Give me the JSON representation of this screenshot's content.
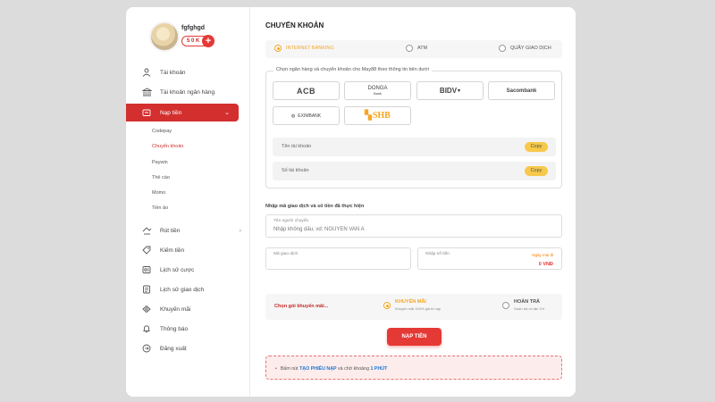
{
  "user": {
    "name": "fgfghgd",
    "balance": "5 0 K",
    "add_symbol": "+"
  },
  "sidebar": {
    "items": [
      {
        "label": "Tài khoản",
        "icon": "user-icon"
      },
      {
        "label": "Tài khoản ngân hàng",
        "icon": "bank-icon"
      },
      {
        "label": "Nạp tiền",
        "icon": "wallet-icon",
        "active": true
      },
      {
        "label": "Rút tiền",
        "icon": "withdraw-icon"
      },
      {
        "label": "Kiếm tiền",
        "icon": "tag-icon"
      },
      {
        "label": "Lịch sử cược",
        "icon": "bet-history-icon"
      },
      {
        "label": "Lịch sử giao dịch",
        "icon": "transaction-history-icon"
      },
      {
        "label": "Khuyến mãi",
        "icon": "gift-icon"
      },
      {
        "label": "Thông báo",
        "icon": "bell-icon"
      },
      {
        "label": "Đăng xuất",
        "icon": "logout-icon"
      }
    ],
    "sub_items": [
      "Codepay",
      "Chuyển khoản",
      "Paywin",
      "Thẻ cào",
      "Momo",
      "Tiền ảo"
    ],
    "chevron_right": "›",
    "chevron_down": "⌄"
  },
  "main": {
    "title": "CHUYỂN KHOẢN",
    "tabs": [
      {
        "label": "INTERNET BANKING",
        "selected": true
      },
      {
        "label": "ATM",
        "selected": false
      },
      {
        "label": "QUẦY GIAO DỊCH",
        "selected": false
      }
    ],
    "bank_legend": "Chọn ngân hàng và chuyển khoản cho May88 theo thông tin bên dưới",
    "banks": [
      {
        "name": "ACB",
        "sub": ""
      },
      {
        "name": "DONGA",
        "sub": "Bank"
      },
      {
        "name": "BIDV",
        "sub": ""
      },
      {
        "name": "Sacombank",
        "sub": ""
      },
      {
        "name": "EXIMBANK",
        "sub": ""
      },
      {
        "name": "SHB",
        "sub": ""
      }
    ],
    "account_name_label": "Tên tài khoản",
    "account_number_label": "Số tài khoản",
    "copy_label": "Copy",
    "transaction_section_label": "Nhập mã giao dịch và số tiền đã thực hiện",
    "sender_label": "Tên người chuyển",
    "sender_placeholder": "Nhập không dấu, vd: NGUYEN VAN A",
    "txn_code_label": "Mã giao dịch",
    "amount_label": "Nhập số tiền",
    "amount_min_max": "Ngày mai đi",
    "amount_value": "0 VNĐ",
    "promo": {
      "label": "Chọn gói khuyến mãi...",
      "option1_title": "KHUYẾN MÃI",
      "option1_sub": "Khuyến mãi 100% giá trị nạp",
      "option2_title": "HOÀN TRẢ",
      "option2_sub": "Hoàn trả vô tận 1%"
    },
    "submit_label": "NẠP TIỀN",
    "notice": {
      "before": "Bấm nút ",
      "highlight1": "TẠO PHIẾU NẠP",
      "middle": " và chờ khoảng ",
      "highlight2": "1 PHÚT"
    }
  }
}
